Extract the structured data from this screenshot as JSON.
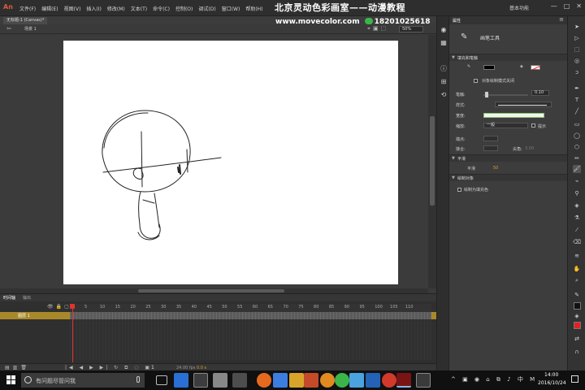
{
  "app": {
    "logo": "An",
    "menu": [
      "文件(F)",
      "编辑(E)",
      "视图(V)",
      "插入(I)",
      "修改(M)",
      "文本(T)",
      "命令(C)",
      "控制(O)",
      "调试(D)",
      "窗口(W)",
      "帮助(H)"
    ],
    "workspace": "基本功能",
    "window_buttons": [
      "—",
      "□",
      "✕"
    ]
  },
  "watermark": {
    "title": "北京灵动色彩画室——动漫教程",
    "url": "www.movecolor.com",
    "phone": "18201025618"
  },
  "document": {
    "tab": "无标题-1 (Canvas)*",
    "scene": "场景 1",
    "zoom": "50%"
  },
  "timeline": {
    "tabs": [
      "时间轴",
      "输出"
    ],
    "layer_name": "图层 1",
    "ruler_ticks": [
      "1",
      "5",
      "10",
      "15",
      "20",
      "25",
      "30",
      "35",
      "40",
      "45",
      "50",
      "55",
      "60",
      "65",
      "70",
      "75",
      "80",
      "85",
      "90",
      "95",
      "100",
      "105",
      "110"
    ],
    "frame": "1",
    "fps": "24.00 fps",
    "time": "0.0 s"
  },
  "properties": {
    "tab": "属性",
    "tool_name": "画笔工具",
    "sections": {
      "fill_stroke": "填充和笔触",
      "smoothing": "平滑",
      "drawing_object": "绘制对象"
    },
    "object_drawing_mode": "对象绘制模式关闭",
    "stroke_label": "笔触:",
    "stroke_value": "0.10",
    "style_label": "样式:",
    "width_label": "宽度:",
    "scale_label": "缩放:",
    "scale_value": "一般",
    "hinting": "提示",
    "cap_label": "端点:",
    "join_label": "接合:",
    "miter_label": "尖角:",
    "miter_value": "3.00",
    "smooth_label": "平滑",
    "smooth_value": "50",
    "draw_as_fill": "绘制为填充色"
  },
  "taskbar": {
    "search_placeholder": "有问题尽管问我",
    "time": "14:00",
    "date": "2016/10/24"
  },
  "colors": {
    "stroke_color": "#000000",
    "fill_color": "#e62020",
    "layer_highlight": "#a8892a",
    "playhead": "#e0332f"
  }
}
